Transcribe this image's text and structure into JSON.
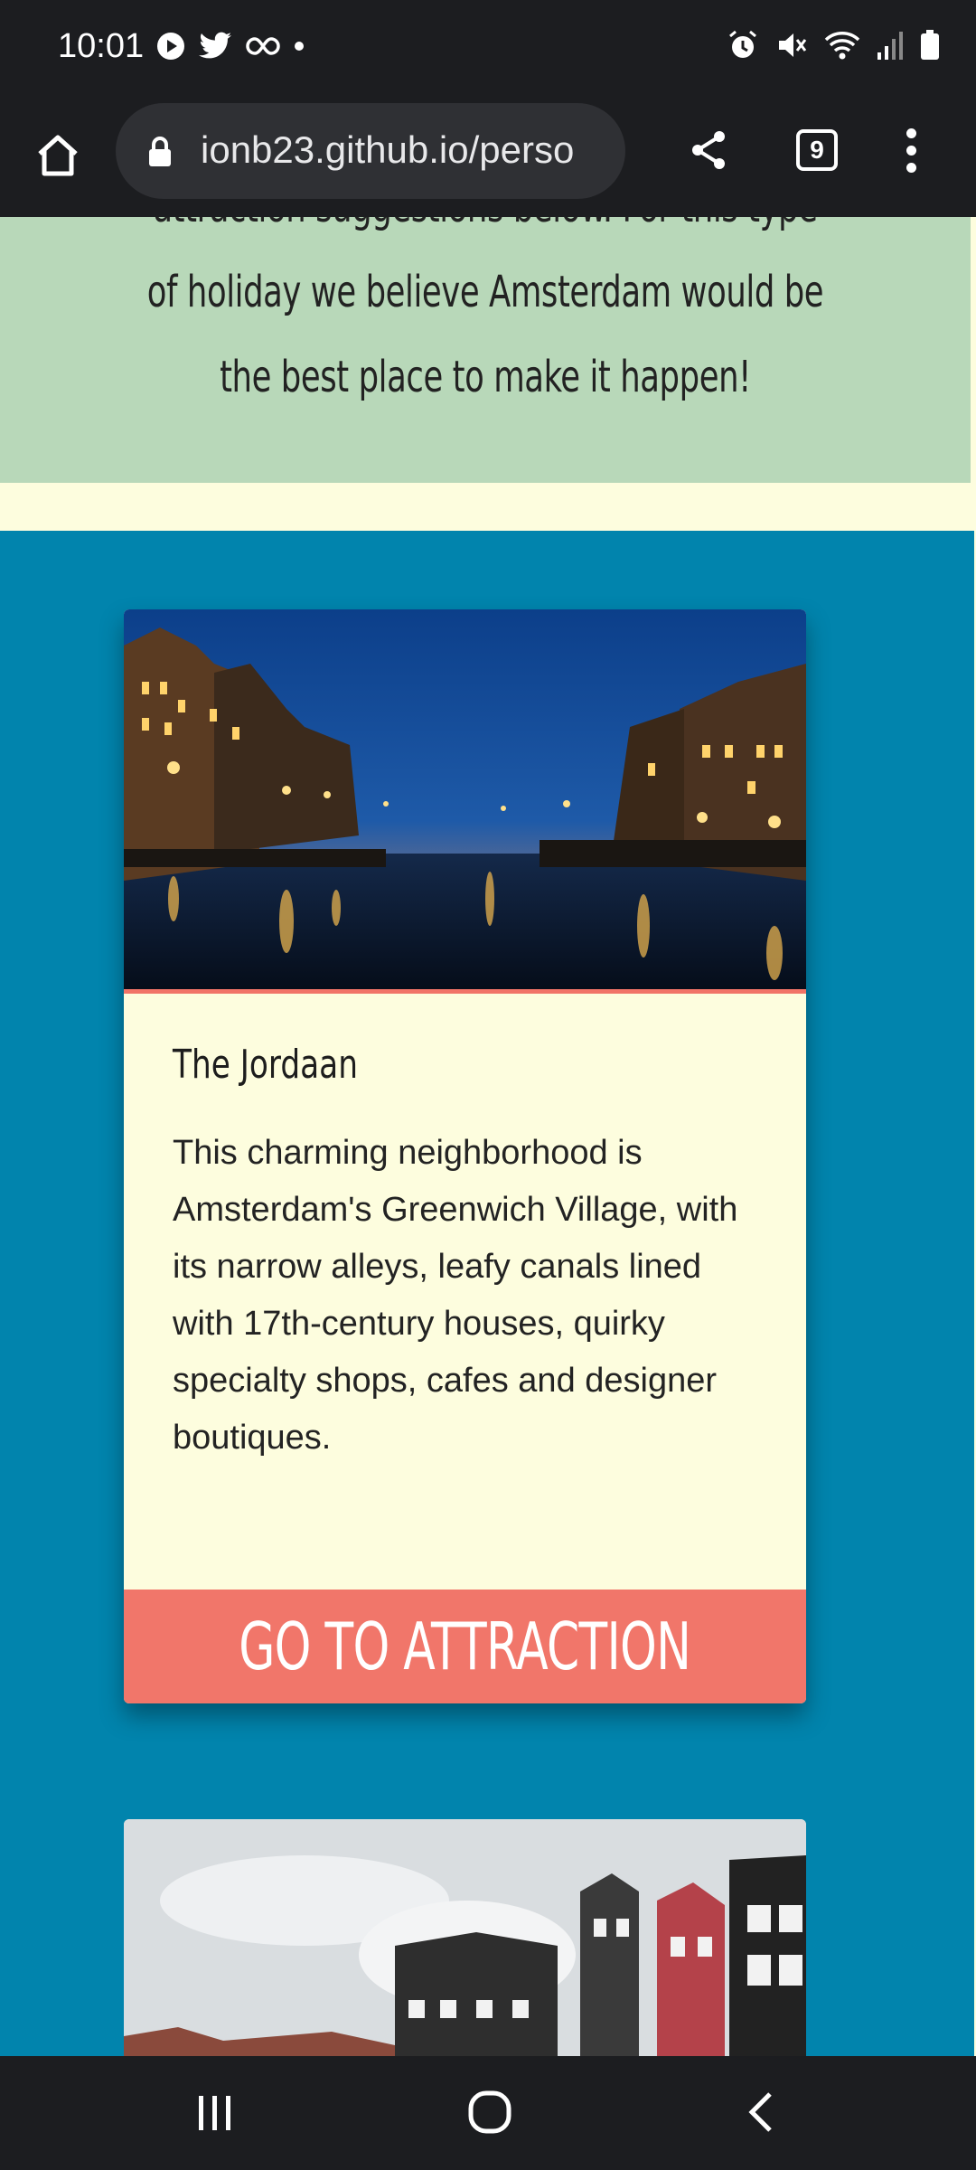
{
  "status_bar": {
    "time": "10:01",
    "left_icons": [
      "play-icon",
      "twitter-bird-icon",
      "infinity-icon",
      "dot-icon"
    ],
    "right_icons": [
      "alarm-icon",
      "mute-icon",
      "wifi-icon",
      "signal-icon",
      "battery-icon"
    ]
  },
  "browser": {
    "url": "ionb23.github.io/perso",
    "tab_count": "9"
  },
  "page": {
    "intro_lines": [
      "attraction suggestions below. For this type",
      "of holiday we believe Amsterdam would be",
      "the best place to make it happen!"
    ],
    "attraction": {
      "title": "The Jordaan",
      "description": "This charming neighborhood is Amsterdam's Greenwich Village, with its narrow alleys, leafy canals lined with 17th-century houses, quirky specialty shops, cafes and designer boutiques.",
      "button_label": "GO TO ATTRACTION"
    }
  },
  "colors": {
    "intro_panel": "#b8d8b9",
    "section_blue": "#0184ad",
    "card_background": "#fdfdde",
    "button": "#f1766a"
  },
  "nav_bar": {
    "icons": [
      "recent-apps-icon",
      "home-circle-icon",
      "back-icon"
    ]
  }
}
